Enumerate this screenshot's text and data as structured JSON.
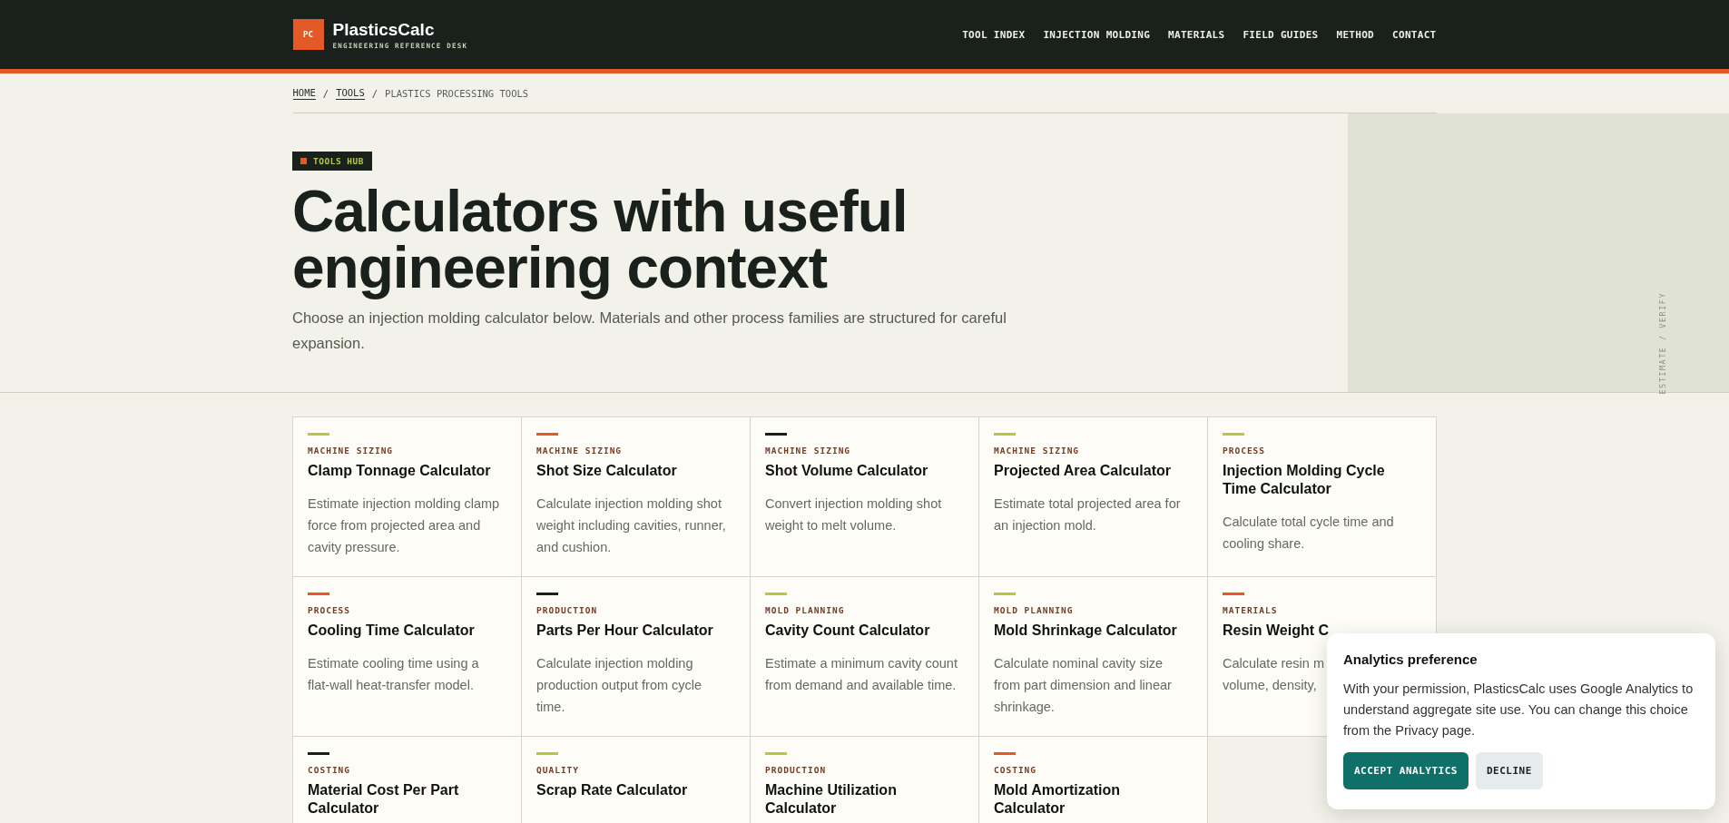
{
  "header": {
    "logo_mark": "PC",
    "brand": "PlasticsCalc",
    "tagline": "ENGINEERING REFERENCE DESK",
    "nav": [
      "TOOL INDEX",
      "INJECTION MOLDING",
      "MATERIALS",
      "FIELD GUIDES",
      "METHOD",
      "CONTACT"
    ]
  },
  "breadcrumb": {
    "separator": "/",
    "items": [
      {
        "label": "HOME",
        "link": true
      },
      {
        "label": "TOOLS",
        "link": true
      },
      {
        "label": "PLASTICS PROCESSING TOOLS",
        "link": false
      }
    ]
  },
  "hero": {
    "badge": "TOOLS HUB",
    "title": "Calculators with useful engineering context",
    "subtitle": "Choose an injection molding calculator below. Materials and other process families are structured for careful expansion.",
    "side_label": "ESTIMATE / VERIFY"
  },
  "cards": [
    {
      "category": "MACHINE SIZING",
      "color": "#b5c842",
      "title": "Clamp Tonnage Calculator",
      "description": [
        "Estimate injection molding clamp",
        "force from projected area and",
        "cavity pressure."
      ]
    },
    {
      "category": "MACHINE SIZING",
      "color": "#e35a26",
      "title": "Shot Size Calculator",
      "description": [
        "Calculate injection molding shot",
        "weight including cavities, runner,",
        "and cushion."
      ]
    },
    {
      "category": "MACHINE SIZING",
      "color": "#1a211d",
      "title": "Shot Volume Calculator",
      "description": [
        "Convert injection molding shot",
        "weight to melt volume."
      ]
    },
    {
      "category": "MACHINE SIZING",
      "color": "#b5c842",
      "title": "Projected Area Calculator",
      "description": [
        "Estimate total projected area for",
        "an injection mold."
      ]
    },
    {
      "category": "PROCESS",
      "color": "#b5c842",
      "title": "Injection Molding Cycle Time Calculator",
      "description": [
        "Calculate total cycle time and",
        "cooling share."
      ]
    },
    {
      "category": "PROCESS",
      "color": "#e35a26",
      "title": "Cooling Time Calculator",
      "description": [
        "Estimate cooling time using a",
        "flat-wall heat-transfer model."
      ]
    },
    {
      "category": "PRODUCTION",
      "color": "#1a211d",
      "title": "Parts Per Hour Calculator",
      "description": [
        "Calculate injection molding",
        "production output from cycle",
        "time."
      ]
    },
    {
      "category": "MOLD PLANNING",
      "color": "#b5c842",
      "title": "Cavity Count Calculator",
      "description": [
        "Estimate a minimum cavity count",
        "from demand and available time."
      ]
    },
    {
      "category": "MOLD PLANNING",
      "color": "#b5c842",
      "title": "Mold Shrinkage Calculator",
      "description": [
        "Calculate nominal cavity size",
        "from part dimension and linear",
        "shrinkage."
      ]
    },
    {
      "category": "MATERIALS",
      "color": "#e35a26",
      "title": "Resin Weight C",
      "description": [
        "Calculate resin m",
        "volume, density,"
      ]
    },
    {
      "category": "COSTING",
      "color": "#1a211d",
      "title": "Material Cost Per Part Calculator"
    },
    {
      "category": "QUALITY",
      "color": "#b5c842",
      "title": "Scrap Rate Calculator"
    },
    {
      "category": "PRODUCTION",
      "color": "#b5c842",
      "title": "Machine Utilization Calculator"
    },
    {
      "category": "COSTING",
      "color": "#e35a26",
      "title": "Mold Amortization Calculator"
    }
  ],
  "consent": {
    "title": "Analytics preference",
    "text": "With your permission, PlasticsCalc uses Google Analytics to understand aggregate site use. You can change this choice from the Privacy page.",
    "buttons": [
      {
        "label": "ACCEPT ANALYTICS",
        "kind": "primary"
      },
      {
        "label": "DECLINE",
        "kind": "secondary"
      }
    ]
  }
}
